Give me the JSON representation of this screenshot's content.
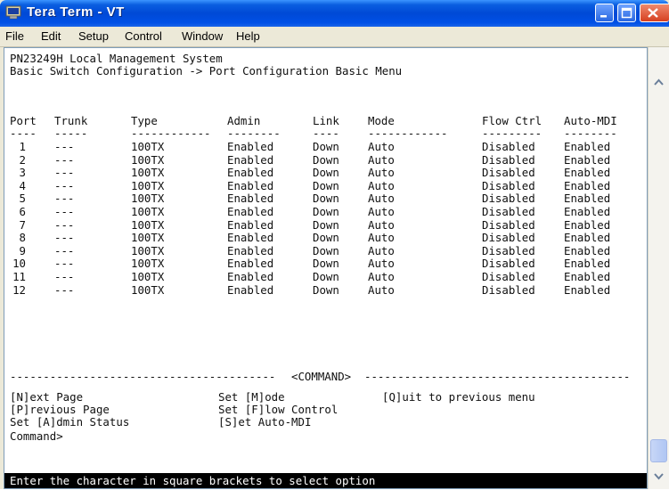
{
  "window": {
    "title": "Tera Term - VT",
    "colors": {
      "titlebar": "#0050e6",
      "close": "#d64020",
      "terminal_bg": "#ffffff",
      "status_bg": "#000000"
    }
  },
  "menu": [
    "File",
    "Edit",
    "Setup",
    "Control",
    "Window",
    "Help"
  ],
  "terminal": {
    "header_line1": "PN23249H Local Management System",
    "header_line2": "Basic Switch Configuration -> Port Configuration Basic Menu",
    "columns": [
      "Port",
      "Trunk",
      "Type",
      "Admin",
      "Link",
      "Mode",
      "Flow Ctrl",
      "Auto-MDI"
    ],
    "column_underlines": [
      "----",
      "-----",
      "------------",
      "--------",
      "----",
      "------------",
      "---------",
      "--------"
    ],
    "rows": [
      [
        "1",
        "---",
        "100TX",
        "Enabled",
        "Down",
        "Auto",
        "Disabled",
        "Enabled"
      ],
      [
        "2",
        "---",
        "100TX",
        "Enabled",
        "Down",
        "Auto",
        "Disabled",
        "Enabled"
      ],
      [
        "3",
        "---",
        "100TX",
        "Enabled",
        "Down",
        "Auto",
        "Disabled",
        "Enabled"
      ],
      [
        "4",
        "---",
        "100TX",
        "Enabled",
        "Down",
        "Auto",
        "Disabled",
        "Enabled"
      ],
      [
        "5",
        "---",
        "100TX",
        "Enabled",
        "Down",
        "Auto",
        "Disabled",
        "Enabled"
      ],
      [
        "6",
        "---",
        "100TX",
        "Enabled",
        "Down",
        "Auto",
        "Disabled",
        "Enabled"
      ],
      [
        "7",
        "---",
        "100TX",
        "Enabled",
        "Down",
        "Auto",
        "Disabled",
        "Enabled"
      ],
      [
        "8",
        "---",
        "100TX",
        "Enabled",
        "Down",
        "Auto",
        "Disabled",
        "Enabled"
      ],
      [
        "9",
        "---",
        "100TX",
        "Enabled",
        "Down",
        "Auto",
        "Disabled",
        "Enabled"
      ],
      [
        "10",
        "---",
        "100TX",
        "Enabled",
        "Down",
        "Auto",
        "Disabled",
        "Enabled"
      ],
      [
        "11",
        "---",
        "100TX",
        "Enabled",
        "Down",
        "Auto",
        "Disabled",
        "Enabled"
      ],
      [
        "12",
        "---",
        "100TX",
        "Enabled",
        "Down",
        "Auto",
        "Disabled",
        "Enabled"
      ]
    ],
    "divider_label": "<COMMAND>",
    "commands": {
      "col1": [
        "[N]ext Page",
        "[P]revious Page",
        "Set [A]dmin Status"
      ],
      "col2": [
        "Set [M]ode",
        "Set [F]low Control",
        "[S]et Auto-MDI"
      ],
      "col3": [
        "[Q]uit to previous menu"
      ]
    },
    "prompt": "Command>",
    "status": "Enter the character in square brackets to select option"
  },
  "icons": {
    "app": "tera-term-monitor-icon",
    "minimize": "minimize-icon",
    "maximize": "maximize-icon",
    "close": "close-icon",
    "scroll_up": "scroll-up-arrow-icon",
    "scroll_down": "scroll-down-arrow-icon"
  }
}
